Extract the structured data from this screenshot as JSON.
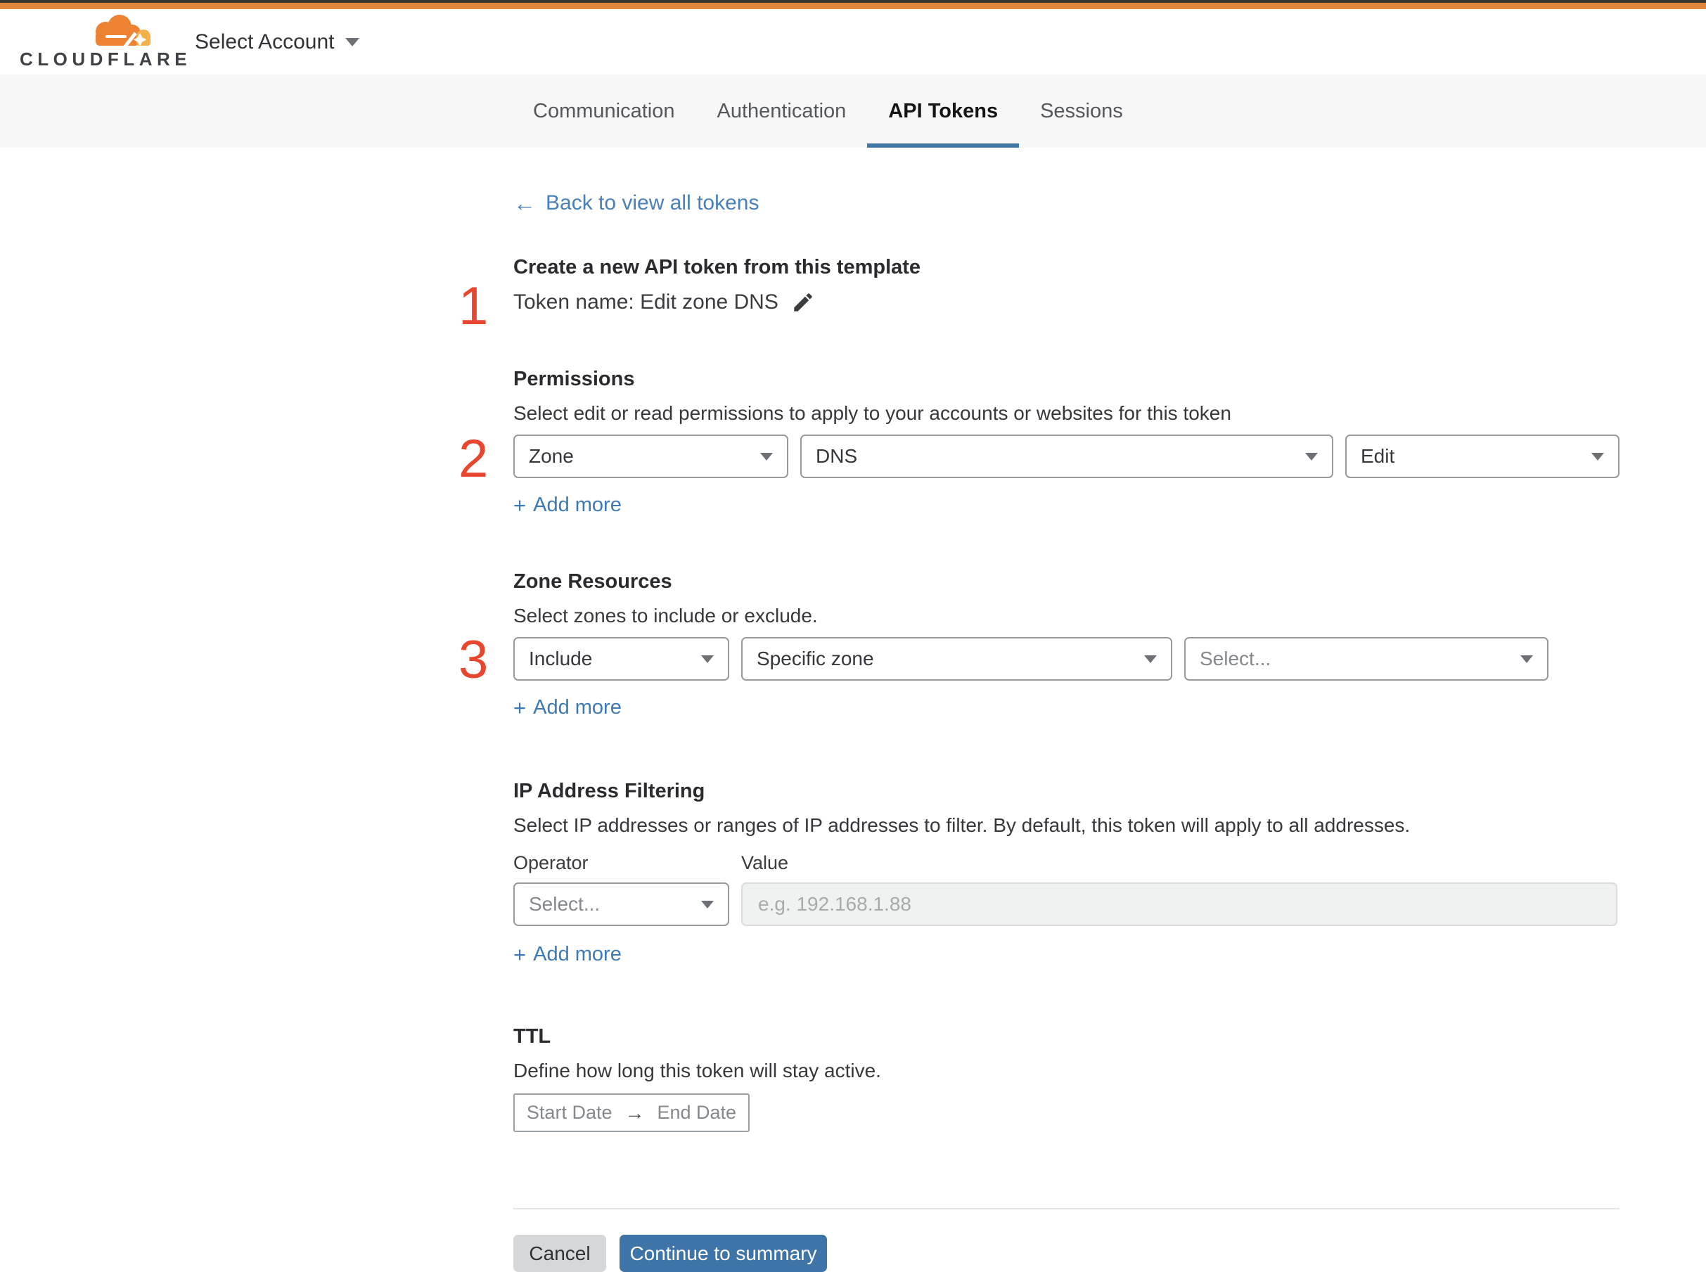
{
  "colors": {
    "topbar_dark": "#3a342e",
    "brand_orange": "#e0853a",
    "logo_cloud_orange": "#ee8233",
    "logo_cloud_light": "#f5b04b",
    "accent_link_blue": "#4a80b5",
    "tab_underline_blue": "#4476a6",
    "step_number_red": "#e8462e",
    "continue_button_blue": "#3e74a8",
    "cancel_button_gray": "#d6d7d8",
    "tabbar_background": "#f7f7f8"
  },
  "header": {
    "logo_text": "CLOUDFLARE",
    "account_selector_label": "Select Account"
  },
  "tabs": {
    "items": [
      {
        "label": "Communication",
        "active": false
      },
      {
        "label": "Authentication",
        "active": false
      },
      {
        "label": "API Tokens",
        "active": true
      },
      {
        "label": "Sessions",
        "active": false
      }
    ]
  },
  "back_link": {
    "label": "Back to view all tokens"
  },
  "token": {
    "step": "1",
    "heading": "Create a new API token from this template",
    "name_line": "Token name: Edit zone DNS"
  },
  "permissions": {
    "step": "2",
    "heading": "Permissions",
    "description": "Select edit or read permissions to apply to your accounts or websites for this token",
    "scope_value": "Zone",
    "resource_value": "DNS",
    "access_value": "Edit",
    "add_more_label": "Add more"
  },
  "zone_resources": {
    "step": "3",
    "heading": "Zone Resources",
    "description": "Select zones to include or exclude.",
    "mode_value": "Include",
    "type_value": "Specific zone",
    "zone_placeholder": "Select...",
    "add_more_label": "Add more"
  },
  "ip_filtering": {
    "heading": "IP Address Filtering",
    "description": "Select IP addresses or ranges of IP addresses to filter. By default, this token will apply to all addresses.",
    "operator_label": "Operator",
    "value_label": "Value",
    "operator_placeholder": "Select...",
    "value_placeholder": "e.g. 192.168.1.88",
    "add_more_label": "Add more"
  },
  "ttl": {
    "heading": "TTL",
    "description": "Define how long this token will stay active.",
    "start_label": "Start Date",
    "end_label": "End Date"
  },
  "footer": {
    "cancel_label": "Cancel",
    "continue_label": "Continue to summary"
  },
  "icons": {
    "plus": "+",
    "back_arrow": "←",
    "range_arrow": "→"
  }
}
